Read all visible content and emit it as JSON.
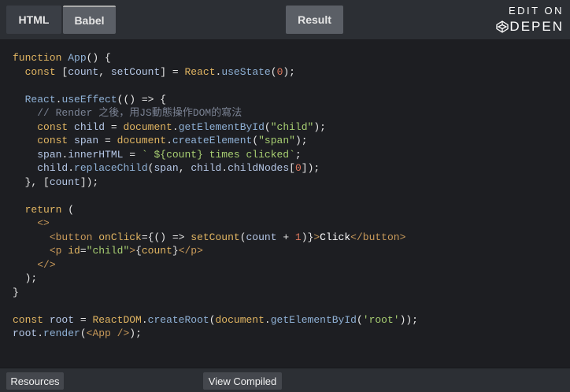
{
  "tabs": {
    "html": "HTML",
    "babel": "Babel",
    "result": "Result"
  },
  "codepen": {
    "edit_on": "EDIT ON",
    "brand": "DEPEN",
    "brand_prefix": "C"
  },
  "code_lines": [
    [
      {
        "t": "kw",
        "v": "function "
      },
      {
        "t": "fn",
        "v": "App"
      },
      {
        "t": "pu",
        "v": "() {"
      }
    ],
    [
      {
        "t": "pu",
        "v": "  "
      },
      {
        "t": "kw",
        "v": "const "
      },
      {
        "t": "pu",
        "v": "["
      },
      {
        "t": "id",
        "v": "count"
      },
      {
        "t": "pu",
        "v": ", "
      },
      {
        "t": "id",
        "v": "setCount"
      },
      {
        "t": "pu",
        "v": "] = "
      },
      {
        "t": "kw",
        "v": "React"
      },
      {
        "t": "pu",
        "v": "."
      },
      {
        "t": "fn",
        "v": "useState"
      },
      {
        "t": "pu",
        "v": "("
      },
      {
        "t": "nu",
        "v": "0"
      },
      {
        "t": "pu",
        "v": ");"
      }
    ],
    [],
    [
      {
        "t": "pu",
        "v": "  "
      },
      {
        "t": "fn",
        "v": "React"
      },
      {
        "t": "pu",
        "v": "."
      },
      {
        "t": "fn",
        "v": "useEffect"
      },
      {
        "t": "pu",
        "v": "(() => {"
      }
    ],
    [
      {
        "t": "cm",
        "v": "    // Render 之後，用JS動態操作DOM的寫法"
      }
    ],
    [
      {
        "t": "pu",
        "v": "    "
      },
      {
        "t": "kw",
        "v": "const "
      },
      {
        "t": "id",
        "v": "child"
      },
      {
        "t": "pu",
        "v": " = "
      },
      {
        "t": "kw",
        "v": "document"
      },
      {
        "t": "pu",
        "v": "."
      },
      {
        "t": "fn",
        "v": "getElementById"
      },
      {
        "t": "pu",
        "v": "("
      },
      {
        "t": "st",
        "v": "\"child\""
      },
      {
        "t": "pu",
        "v": ");"
      }
    ],
    [
      {
        "t": "pu",
        "v": "    "
      },
      {
        "t": "kw",
        "v": "const "
      },
      {
        "t": "id",
        "v": "span"
      },
      {
        "t": "pu",
        "v": " = "
      },
      {
        "t": "kw",
        "v": "document"
      },
      {
        "t": "pu",
        "v": "."
      },
      {
        "t": "fn",
        "v": "createElement"
      },
      {
        "t": "pu",
        "v": "("
      },
      {
        "t": "st",
        "v": "\"span\""
      },
      {
        "t": "pu",
        "v": ");"
      }
    ],
    [
      {
        "t": "pu",
        "v": "    "
      },
      {
        "t": "id",
        "v": "span"
      },
      {
        "t": "pu",
        "v": "."
      },
      {
        "t": "id",
        "v": "innerHTML"
      },
      {
        "t": "pu",
        "v": " = "
      },
      {
        "t": "st",
        "v": "` ${count} times clicked`"
      },
      {
        "t": "pu",
        "v": ";"
      }
    ],
    [
      {
        "t": "pu",
        "v": "    "
      },
      {
        "t": "id",
        "v": "child"
      },
      {
        "t": "pu",
        "v": "."
      },
      {
        "t": "fn",
        "v": "replaceChild"
      },
      {
        "t": "pu",
        "v": "("
      },
      {
        "t": "id",
        "v": "span"
      },
      {
        "t": "pu",
        "v": ", "
      },
      {
        "t": "id",
        "v": "child"
      },
      {
        "t": "pu",
        "v": "."
      },
      {
        "t": "id",
        "v": "childNodes"
      },
      {
        "t": "pu",
        "v": "["
      },
      {
        "t": "nu",
        "v": "0"
      },
      {
        "t": "pu",
        "v": "]);"
      }
    ],
    [
      {
        "t": "pu",
        "v": "  }, ["
      },
      {
        "t": "id",
        "v": "count"
      },
      {
        "t": "pu",
        "v": "]);"
      }
    ],
    [],
    [
      {
        "t": "pu",
        "v": "  "
      },
      {
        "t": "kw",
        "v": "return"
      },
      {
        "t": "pu",
        "v": " ("
      }
    ],
    [
      {
        "t": "pu",
        "v": "    "
      },
      {
        "t": "tg",
        "v": "<>"
      }
    ],
    [
      {
        "t": "pu",
        "v": "      "
      },
      {
        "t": "tg",
        "v": "<button "
      },
      {
        "t": "at",
        "v": "onClick"
      },
      {
        "t": "pu",
        "v": "={() => "
      },
      {
        "t": "at",
        "v": "setCount"
      },
      {
        "t": "pu",
        "v": "("
      },
      {
        "t": "id",
        "v": "count"
      },
      {
        "t": "pu",
        "v": " + "
      },
      {
        "t": "nu",
        "v": "1"
      },
      {
        "t": "pu",
        "v": ")}"
      },
      {
        "t": "tg",
        "v": ">"
      },
      {
        "t": "tx",
        "v": "Click"
      },
      {
        "t": "tg",
        "v": "</button>"
      }
    ],
    [
      {
        "t": "pu",
        "v": "      "
      },
      {
        "t": "tg",
        "v": "<p "
      },
      {
        "t": "at",
        "v": "id"
      },
      {
        "t": "pu",
        "v": "="
      },
      {
        "t": "st",
        "v": "\"child\""
      },
      {
        "t": "tg",
        "v": ">"
      },
      {
        "t": "pu",
        "v": "{"
      },
      {
        "t": "at",
        "v": "count"
      },
      {
        "t": "pu",
        "v": "}"
      },
      {
        "t": "tg",
        "v": "</p>"
      }
    ],
    [
      {
        "t": "pu",
        "v": "    "
      },
      {
        "t": "tg",
        "v": "</>"
      }
    ],
    [
      {
        "t": "pu",
        "v": "  );"
      }
    ],
    [
      {
        "t": "pu",
        "v": "}"
      }
    ],
    [],
    [
      {
        "t": "kw",
        "v": "const "
      },
      {
        "t": "id",
        "v": "root"
      },
      {
        "t": "pu",
        "v": " = "
      },
      {
        "t": "kw",
        "v": "ReactDOM"
      },
      {
        "t": "pu",
        "v": "."
      },
      {
        "t": "fn",
        "v": "createRoot"
      },
      {
        "t": "pu",
        "v": "("
      },
      {
        "t": "kw",
        "v": "document"
      },
      {
        "t": "pu",
        "v": "."
      },
      {
        "t": "fn",
        "v": "getElementById"
      },
      {
        "t": "pu",
        "v": "("
      },
      {
        "t": "st",
        "v": "'root'"
      },
      {
        "t": "pu",
        "v": "));"
      }
    ],
    [
      {
        "t": "id",
        "v": "root"
      },
      {
        "t": "pu",
        "v": "."
      },
      {
        "t": "fn",
        "v": "render"
      },
      {
        "t": "pu",
        "v": "("
      },
      {
        "t": "tg",
        "v": "<App />"
      },
      {
        "t": "pu",
        "v": ");"
      }
    ]
  ],
  "bottom": {
    "resources": "Resources",
    "view_compiled": "View Compiled"
  }
}
